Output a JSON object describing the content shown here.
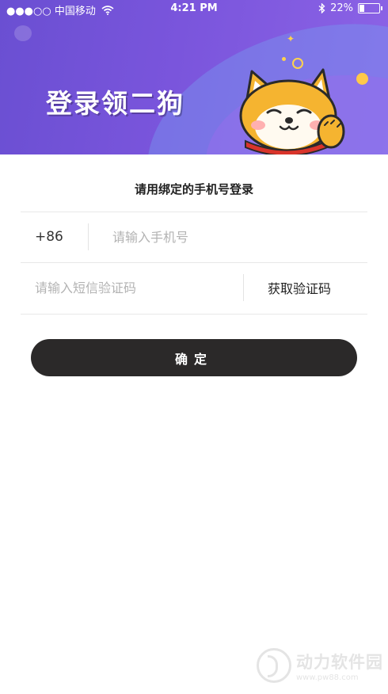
{
  "status_bar": {
    "signal": "●●●○○",
    "carrier": "中国移动",
    "wifi_icon": "wifi-icon",
    "time": "4:21 PM",
    "bluetooth_icon": "bluetooth-icon",
    "battery_percent": "22%",
    "battery_level": 0.22
  },
  "banner": {
    "title": "登录领二狗",
    "mascot_icon": "shiba-dog-icon"
  },
  "login": {
    "subtitle": "请用绑定的手机号登录",
    "country_code": "+86",
    "phone_placeholder": "请输入手机号",
    "sms_placeholder": "请输入短信验证码",
    "get_code_label": "获取验证码",
    "confirm_label": "确定"
  },
  "watermark": {
    "name": "动力软件园",
    "url": "www.pw88.com"
  },
  "colors": {
    "header_start": "#6a4fd2",
    "header_end": "#8c63e6",
    "button_bg": "#2b2929",
    "accent_yellow": "#ffc94a"
  }
}
